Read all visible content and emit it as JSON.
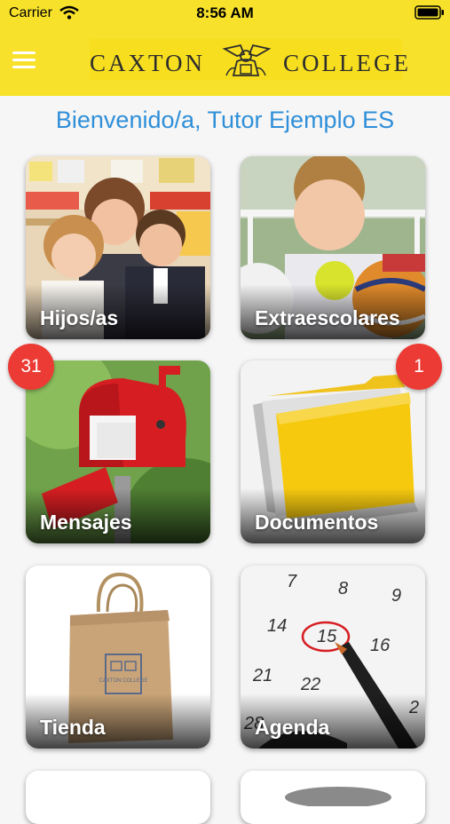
{
  "status_bar": {
    "carrier": "Carrier",
    "time": "8:56 AM"
  },
  "header": {
    "logo_left": "CAXTON",
    "logo_right": "COLLEGE",
    "background": "#f7e12b"
  },
  "welcome": "Bienvenido/a, Tutor Ejemplo ES",
  "tiles": [
    {
      "label": "Hijos/as"
    },
    {
      "label": "Extraescolares"
    },
    {
      "label": "Mensajes",
      "badge": "31"
    },
    {
      "label": "Documentos",
      "badge": "1"
    },
    {
      "label": "Tienda"
    },
    {
      "label": "Agenda"
    }
  ],
  "calendar_numbers": [
    "7",
    "8",
    "9",
    "14",
    "15",
    "16",
    "21",
    "22",
    "28",
    "2"
  ],
  "bag_print": "CAXTON COLLEGE",
  "accent_color": "#2f8fd8",
  "badge_color": "#ec3b34"
}
